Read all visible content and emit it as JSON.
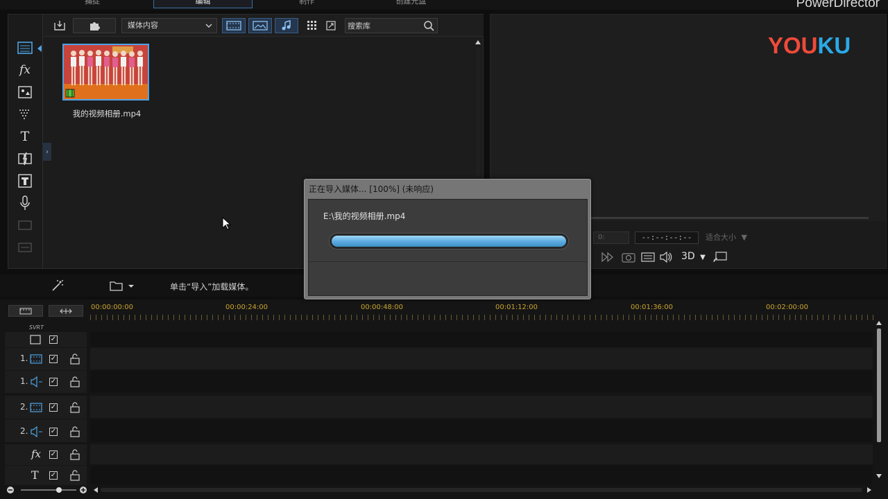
{
  "top_tabs": [
    {
      "label": "捕捉"
    },
    {
      "label": "编辑"
    },
    {
      "label": "制作"
    },
    {
      "label": "创建光盘"
    }
  ],
  "app_title": "PowerDirector",
  "library": {
    "content_dropdown": "媒体内容",
    "search_placeholder": "搜索库",
    "media_items": [
      {
        "filename": "我的视频相册.mp4"
      }
    ]
  },
  "preview": {
    "watermark": "YOUKU",
    "timecode_left": "0:",
    "timecode": "--:--:--:--",
    "fit_option": "适合大小",
    "mode_3d": "3D"
  },
  "import_dialog": {
    "title": "正在导入媒体... [100%] (未响应)",
    "file_path": "E:\\我的视频相册.mp4",
    "progress": 1.0
  },
  "midbar": {
    "status_text": "单击“导入”加载媒体。"
  },
  "timeline": {
    "ruler_labels": [
      "00:00:00:00",
      "00:00:24:00",
      "00:00:48:00",
      "00:01:12:00",
      "00:01:36:00",
      "00:02:00:00"
    ],
    "svrt_label": "SVRT",
    "tracks": [
      {
        "num": "",
        "kind": "svrt-video"
      },
      {
        "num": "1.",
        "kind": "video"
      },
      {
        "num": "1.",
        "kind": "audio"
      },
      {
        "num": "2.",
        "kind": "video"
      },
      {
        "num": "2.",
        "kind": "audio"
      },
      {
        "num": "",
        "kind": "fx"
      },
      {
        "num": "",
        "kind": "title"
      }
    ]
  },
  "colors": {
    "accent_blue": "#4da3e6",
    "ruler_gold": "#c9a52f",
    "youku_red": "#ef4a3a",
    "youku_blue": "#2aa9e6"
  }
}
